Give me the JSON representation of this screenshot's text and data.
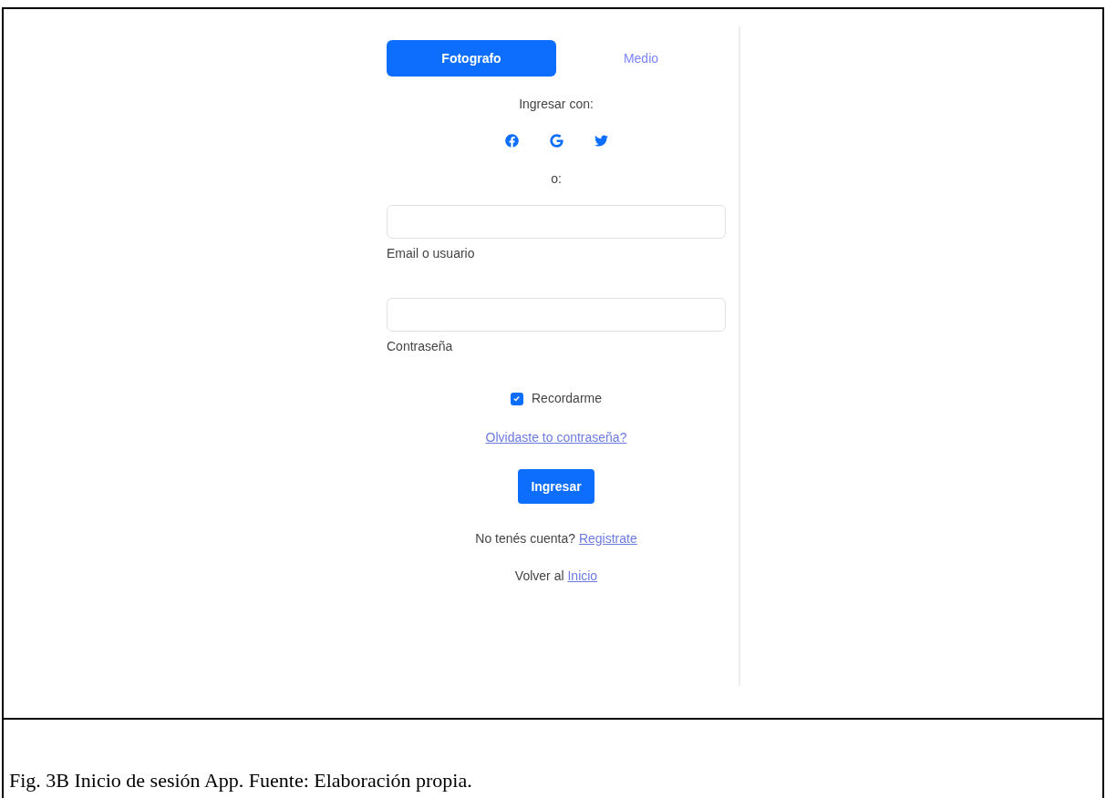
{
  "tabs": [
    {
      "label": "Fotografo",
      "selected": true
    },
    {
      "label": "Medio",
      "selected": false
    }
  ],
  "social_prompt": "Ingresar con:",
  "social_buttons": [
    {
      "kind": "facebook"
    },
    {
      "kind": "google"
    },
    {
      "kind": "twitter"
    }
  ],
  "separator": "o:",
  "fields": [
    {
      "label": "Email o usuario"
    },
    {
      "label": "Contraseña"
    }
  ],
  "remember": {
    "label": "Recordarme",
    "checked": true
  },
  "forgot_link": "Olvidaste to contraseña?",
  "submit": "Ingresar",
  "register": {
    "text": "No tenés cuenta?",
    "link": "Registrate"
  },
  "back": {
    "text": "Volver al",
    "link": "Inicio"
  },
  "caption": "Fig. 3B Inicio de sesión App. Fuente: Elaboración propia."
}
